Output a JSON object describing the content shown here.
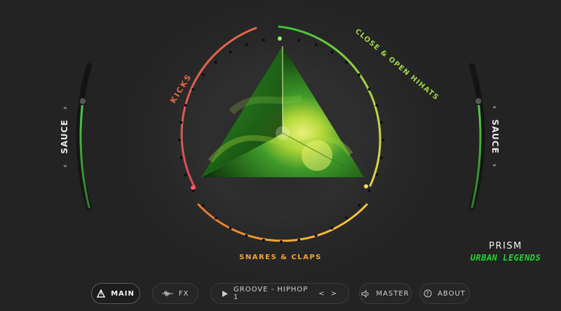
{
  "dial": {
    "labels": {
      "top_right": "CLOSE & OPEN HIHATS",
      "left": "KICKS",
      "bottom": "SNARES & CLAPS"
    },
    "colors": {
      "kicks": "#e05a44",
      "hihats": "#7dd14a",
      "snares": "#f0a330",
      "triangle": "#3f9a2a"
    }
  },
  "left_knob": {
    "label": "SAUCE",
    "left_arrow": "‹",
    "right_arrow": "›",
    "level": 0.75
  },
  "right_knob": {
    "label": "SAUCE",
    "left_arrow": "‹",
    "right_arrow": "›",
    "level": 0.75
  },
  "brand": {
    "name": "PRISM",
    "subtitle": "URBAN LEGENDS"
  },
  "toolbar": {
    "main_label": "MAIN",
    "fx_label": "FX",
    "groove_label": "GROOVE - HIPHOP 1",
    "prev": "<",
    "next": ">",
    "master_label": "MASTER",
    "about_label": "ABOUT"
  }
}
